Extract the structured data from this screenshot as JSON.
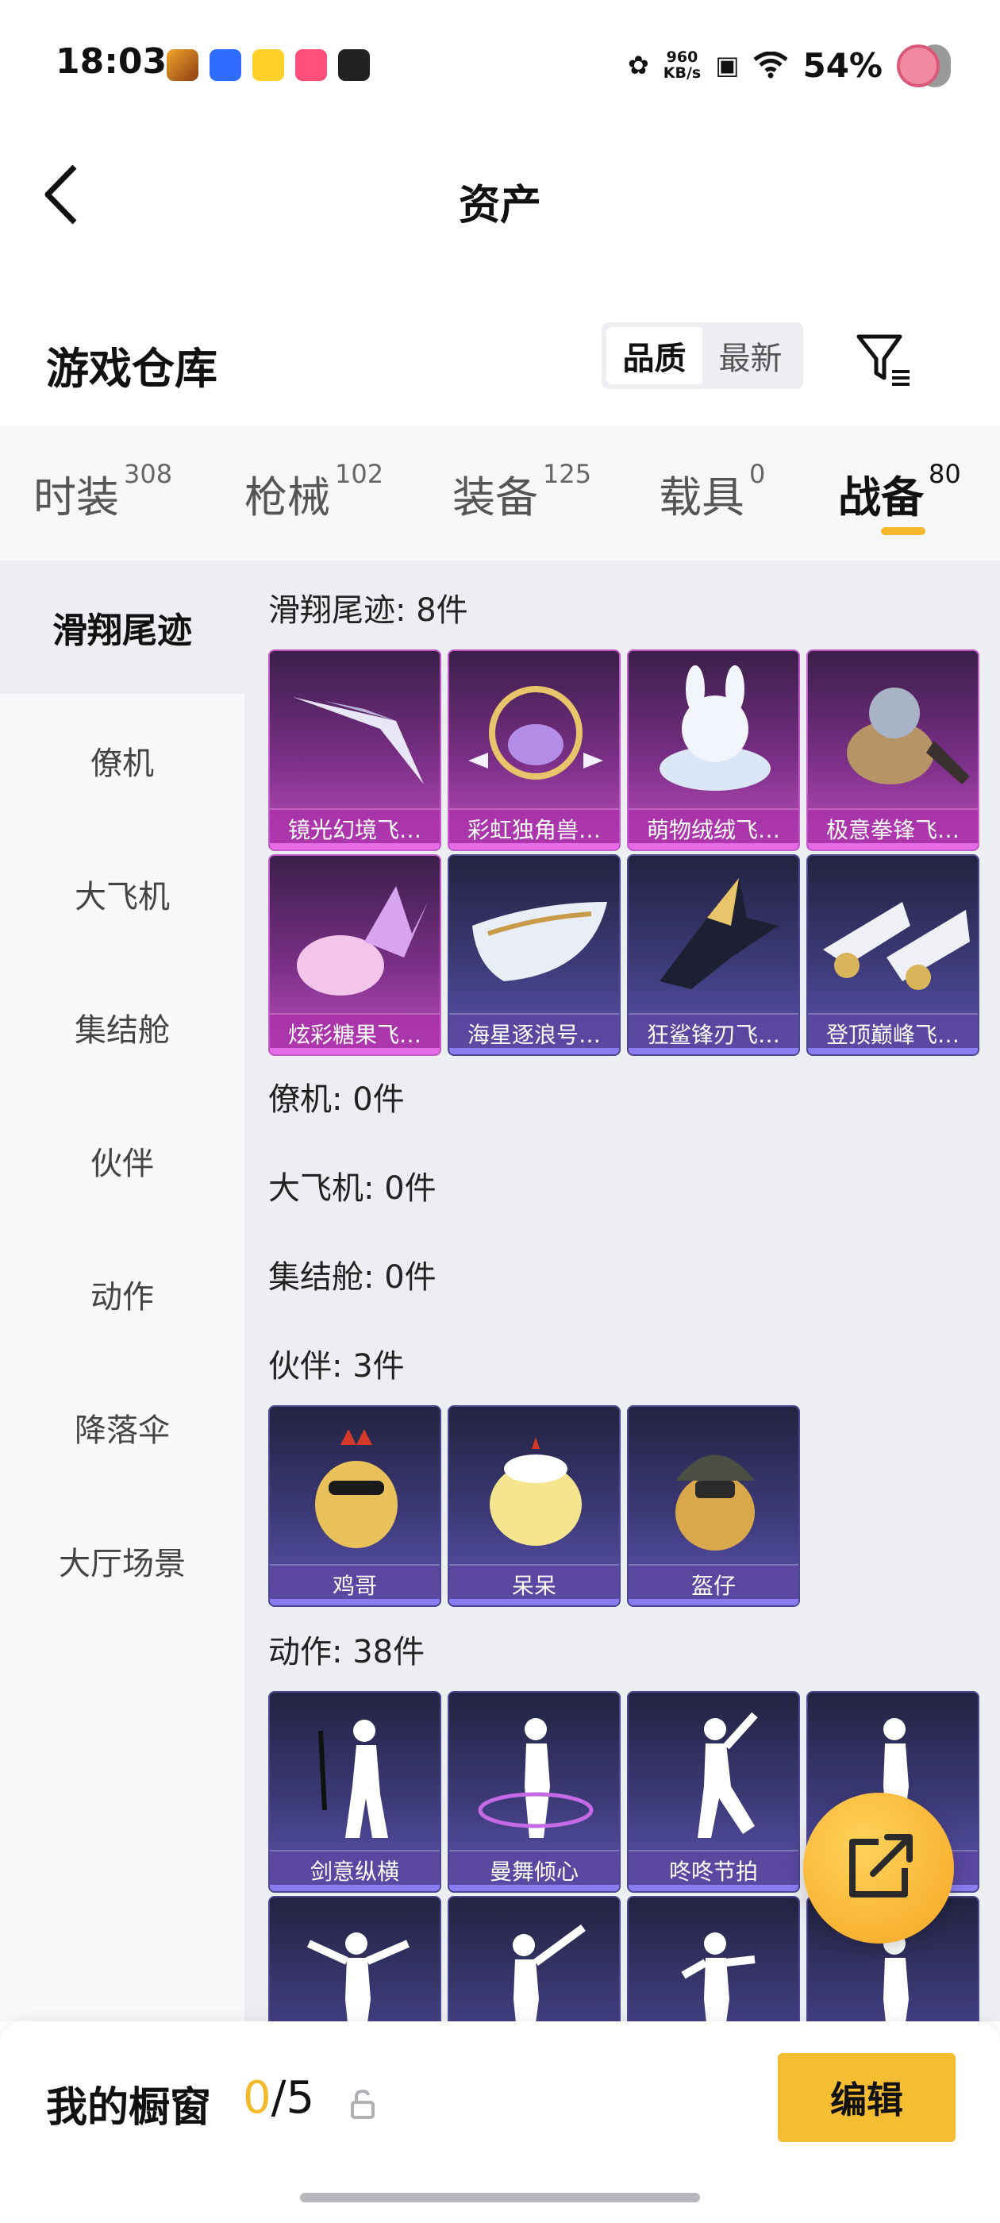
{
  "status_bar": {
    "time": "18:03",
    "network_speed_value": "960",
    "network_speed_unit": "KB/s",
    "battery": "54%"
  },
  "header": {
    "title": "资产"
  },
  "warehouse": {
    "title": "游戏仓库",
    "sort_options": [
      "品质",
      "最新"
    ],
    "active_sort": "品质"
  },
  "tabs": [
    {
      "label": "时装",
      "count": "308"
    },
    {
      "label": "枪械",
      "count": "102"
    },
    {
      "label": "装备",
      "count": "125"
    },
    {
      "label": "载具",
      "count": "0"
    },
    {
      "label": "战备",
      "count": "80"
    }
  ],
  "active_tab": "战备",
  "sidebar": [
    {
      "label": "滑翔尾迹"
    },
    {
      "label": "僚机"
    },
    {
      "label": "大飞机"
    },
    {
      "label": "集结舱"
    },
    {
      "label": "伙伴"
    },
    {
      "label": "动作"
    },
    {
      "label": "降落伞"
    },
    {
      "label": "大厅场景"
    }
  ],
  "active_sidebar": "滑翔尾迹",
  "sections": {
    "glide": {
      "label": "滑翔尾迹: 8件",
      "items": [
        "镜光幻境飞…",
        "彩虹独角兽…",
        "萌物绒绒飞…",
        "极意拳锋飞…",
        "炫彩糖果飞…",
        "海星逐浪号…",
        "狂鲨锋刃飞…",
        "登顶巅峰飞…"
      ]
    },
    "wingman": {
      "label": "僚机: 0件"
    },
    "plane": {
      "label": "大飞机: 0件"
    },
    "pod": {
      "label": "集结舱: 0件"
    },
    "partner": {
      "label": "伙伴: 3件",
      "items": [
        "鸡哥",
        "呆呆",
        "盔仔"
      ]
    },
    "emote": {
      "label": "动作: 38件",
      "items": [
        "剑意纵横",
        "曼舞倾心",
        "咚咚节拍",
        "",
        "",
        "",
        "",
        ""
      ]
    }
  },
  "showcase": {
    "title": "我的橱窗",
    "current": "0",
    "total": "/5",
    "edit_label": "编辑"
  },
  "colors": {
    "accent": "#f5b82a",
    "epic_card": "#c04fc0",
    "rare_card": "#5e55b4"
  }
}
